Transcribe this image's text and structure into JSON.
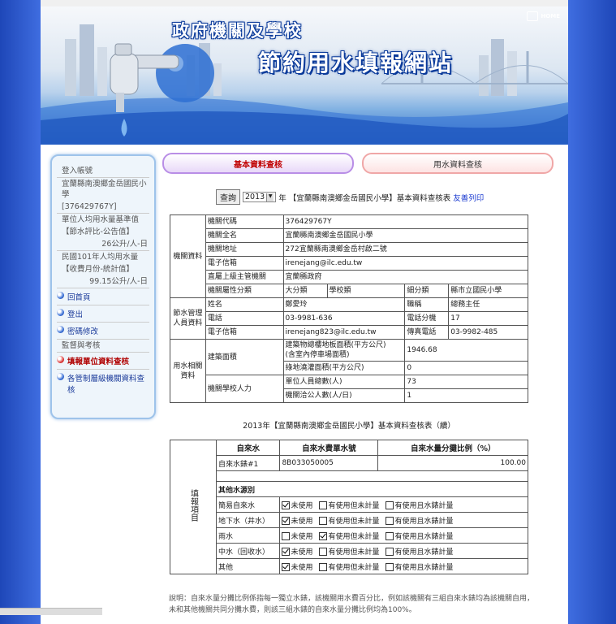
{
  "header": {
    "home_label": "HOME",
    "title_line1": "政府機關及學校",
    "title_line2": "節約用水填報網站"
  },
  "sidebar": {
    "heading": "登入帳號",
    "account_name": "宜蘭縣南澳鄉金岳國民小學",
    "account_code": "[376429767Y]",
    "std_label_1": "單位人均用水量基準值",
    "std_label_2": "【節水評比-公告值】",
    "std_value": "26公升/人-日",
    "usage_label_1": "民國101年人均用水量",
    "usage_label_2": "【收費月份-統計值】",
    "usage_value": "99.15公升/人-日",
    "links": [
      "回首頁",
      "登出",
      "密碼修改"
    ],
    "section": "監督與考核",
    "active_item": "填報單位資料查核",
    "last_item": "各管制層級機關資料查核"
  },
  "tabs": {
    "basic": "基本資料查核",
    "water": "用水資料查核"
  },
  "query": {
    "button": "查詢",
    "year": "2013",
    "year_suffix": "年",
    "title": "【宜蘭縣南澳鄉金岳國民小學】基本資料查核表",
    "print_link": "友善列印"
  },
  "table1": {
    "cat_org": "機關資料",
    "cat_water_mgr": "節水管理人員資料",
    "cat_water_rel": "用水相關資料",
    "org_rows": [
      {
        "label": "機關代碼",
        "value": "376429767Y"
      },
      {
        "label": "機關全名",
        "value": "宜蘭縣南澳鄉金岳國民小學"
      },
      {
        "label": "機關地址",
        "value": "272宜蘭縣南澳鄉金岳村啟二號"
      },
      {
        "label": "電子信箱",
        "value": "irenejang@ilc.edu.tw"
      },
      {
        "label": "直屬上級主管機關",
        "value": "宜蘭縣政府"
      }
    ],
    "class_label": "機關屬性分類",
    "major_label": "大分類",
    "major_value": "學校類",
    "minor_label": "細分類",
    "minor_value": "縣市立國民小學",
    "name_label": "姓名",
    "name_value": "鄭愛玲",
    "title_label": "職稱",
    "title_value": "總務主任",
    "phone_label": "電話",
    "phone_value": "03-9981-636",
    "ext_label": "電話分機",
    "ext_value": "17",
    "email_label": "電子信箱",
    "email_value": "irenejang823@ilc.edu.tw",
    "fax_label": "傳真電話",
    "fax_value": "03-9982-485",
    "area_label": "建築面積",
    "area_floor_label_1": "建築物總樓地板面積(平方公尺)",
    "area_floor_label_2": "(含室內停車場面積)",
    "area_floor_value": "1946.68",
    "area_green_label": "綠地澆灌面積(平方公尺)",
    "area_green_value": "0",
    "staff_label": "機關學校人力",
    "staff_total_label": "單位人員總數(人)",
    "staff_total_value": "73",
    "staff_public_label": "機關洽公人數(人/日)",
    "staff_public_value": "1"
  },
  "caption2": "2013年【宜蘭縣南澳鄉金岳國民小學】基本資料查核表（續）",
  "table2": {
    "side_label": "填報項目",
    "h_tap": "自來水",
    "h_meter": "自來水費單水號",
    "h_pct": "自來水量分攤比例（%）",
    "meter_name": "自來水錶#1",
    "meter_no": "8B033050005",
    "meter_pct": "100.00",
    "other_heading": "其他水源別",
    "opt_none": "未使用",
    "opt_no_meter": "有使用但未計量",
    "opt_meter": "有使用且水錶計量",
    "sources": [
      {
        "name": "簡易自來水",
        "sel": 0
      },
      {
        "name": "地下水（井水）",
        "sel": 0
      },
      {
        "name": "雨水",
        "sel": 1
      },
      {
        "name": "中水（回收水）",
        "sel": 0
      },
      {
        "name": "其他",
        "sel": 0
      }
    ]
  },
  "note": "說明：自來水量分攤比例係指每一獨立水錶，該機關用水費百分比，例如該機關有三組自來水錶均為該機關自用，未和其他機關共同分攤水費，則該三組水錶的自來水量分攤比例均為100%。"
}
